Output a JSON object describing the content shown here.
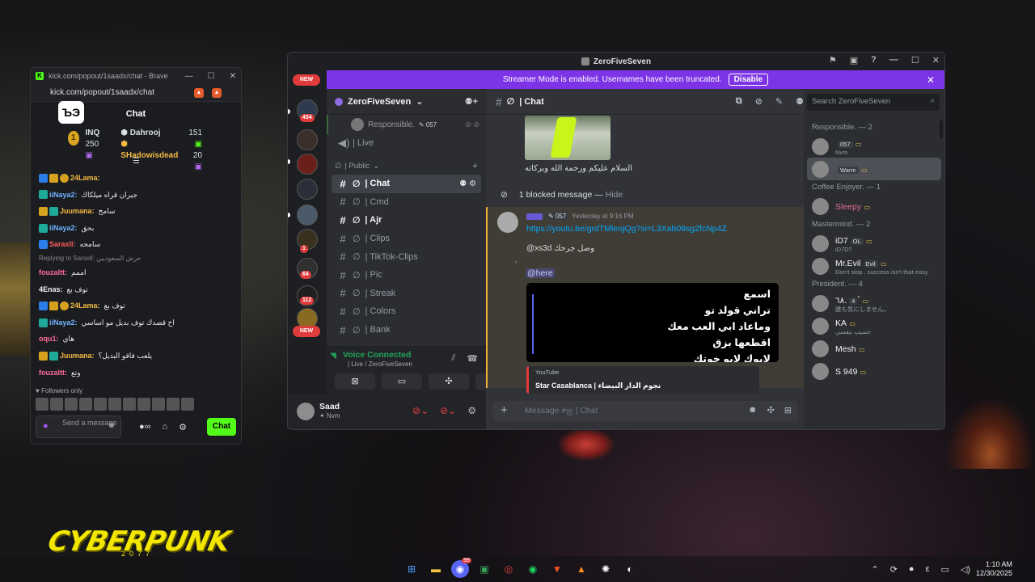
{
  "kick": {
    "tab_title": "kick.com/popout/1saadx/chat - Brave",
    "url": "kick.com/popout/1saadx/chat",
    "header": "Chat",
    "logo": "ЪЭ",
    "leaderboard": {
      "rank": "1",
      "team": "INQ",
      "team_points": "250",
      "u1": "Dahrooj",
      "u1_points": "151",
      "u2": "SHadowisdead",
      "u2_points": "20"
    },
    "messages": [
      {
        "user": "24Lama:",
        "color": "#f5b942",
        "text": "",
        "badges": [
          "b-blue",
          "b-gold",
          "b-cir"
        ]
      },
      {
        "user": "iiNaya2:",
        "color": "#6fb3ff",
        "text": "جيران قراه ميلكاك",
        "badges": [
          "b-teal"
        ]
      },
      {
        "user": "Juumana:",
        "color": "#f5b942",
        "text": "سامح",
        "badges": [
          "b-gold",
          "b-teal"
        ]
      },
      {
        "user": "iiNaya2:",
        "color": "#6fb3ff",
        "text": "بحق",
        "badges": [
          "b-teal"
        ]
      },
      {
        "user": "Saraxll:",
        "color": "#ff5a5a",
        "text": "سامحه",
        "badges": [
          "b-blue"
        ]
      },
      {
        "reply": "Replying to Saraxll: حرش السعوديين"
      },
      {
        "user": "fouzaltt:",
        "color": "#ff6b9a",
        "text": "اممم",
        "badges": []
      },
      {
        "user": "4Enas:",
        "color": "#f2f2f2",
        "text": "توف بع",
        "badges": []
      },
      {
        "user": "24Lama:",
        "color": "#f5b942",
        "text": "توف بع",
        "badges": [
          "b-blue",
          "b-gold",
          "b-cir"
        ]
      },
      {
        "user": "iiNaya2:",
        "color": "#6fb3ff",
        "text": "اح قصدك توف بديل مو اساسي",
        "badges": [
          "b-teal"
        ]
      },
      {
        "user": "oqu1:",
        "color": "#ff6b9a",
        "text": "هاي",
        "badges": []
      },
      {
        "user": "Juumana:",
        "color": "#f5b942",
        "text": "يلعب فاقو البديل؟",
        "badges": [
          "b-gold",
          "b-teal"
        ]
      },
      {
        "user": "fouzaltt:",
        "color": "#ff6b9a",
        "text": "وتع",
        "badges": []
      }
    ],
    "followers_only": "Followers only",
    "input_placeholder": "Send a message",
    "send_label": "Chat"
  },
  "discord": {
    "window_title": "ZeroFiveSeven",
    "banner_text": "Streamer Mode is enabled. Usernames have been truncated.",
    "banner_button": "Disable",
    "new_label": "NEW",
    "server_badges": [
      "434",
      "1",
      "64",
      "112"
    ],
    "server_name": "ZeroFiveSeven",
    "voice_user": "Responsible.",
    "voice_user_tag": "057",
    "voice_channel": "| Live",
    "category": "| Public",
    "channels": [
      "| Chat",
      "| Cmd",
      "| Ajr",
      "| Clips",
      "| TikTok-Clips",
      "| Pic",
      "| Streak",
      "| Colors",
      "| Bank"
    ],
    "voice_connected": "Voice Connected",
    "voice_location": "| Live / ZeroFiveSeven",
    "user_name": "Saad",
    "user_status": "Nvm",
    "channel_header": "| Chat",
    "search_placeholder": "Search ZeroFiveSeven",
    "greeting": "السلام عليكم ورحمة الله وبركاته",
    "blocked": "1 blocked message —",
    "blocked_hide": "Hide",
    "msg_tag": "057",
    "msg_time": "Yesterday at 9:16 PM",
    "msg_link": "https://youtu.be/grdTMleojQg?si=L3Xab09sg2fcNp4Z",
    "msg_arabic": "@xs3d وصل جرحك",
    "msg_here": "@here",
    "lyrics": [
      "اسمع",
      "تراني قولد تو",
      "وماعاد ابي العب معك",
      "اقطعها بزق",
      "لابوك لابو خوتك"
    ],
    "embed_provider": "YouTube",
    "embed_title": "Star Casablanca | نجوم الدار البيضاء",
    "input_placeholder": "Message #ஐ | Chat",
    "members": [
      {
        "group": "Responsible. — 2"
      },
      {
        "name": "",
        "sub": "Nvm",
        "tag": "057"
      },
      {
        "name": "",
        "tag": "Warm",
        "hover": true
      },
      {
        "group": "Coffee Enjoyer. — 1"
      },
      {
        "name": "Sleepy",
        "color": "#e06c8a"
      },
      {
        "group": "Mastermind. — 2"
      },
      {
        "name": "iD7",
        "tag": "OL",
        "sub": "iD7D7"
      },
      {
        "name": "Mr.Evil",
        "tag": "Evil",
        "sub": "Don't stop , success isn't that easy"
      },
      {
        "group": "President. — 4"
      },
      {
        "name": "ٴ٦٨.",
        "tag": "4",
        "sub": "誰も気にしません。"
      },
      {
        "name": "KA",
        "sub": "حسيب بنفسي"
      },
      {
        "name": "Mesh"
      },
      {
        "name": "S 949"
      }
    ]
  },
  "taskbar": {
    "time": "1:10 AM",
    "date": "12/30/2025",
    "discord_badge": "99"
  },
  "wallpaper": {
    "logo": "CYBERPUNK",
    "logo_sub": "2077"
  }
}
